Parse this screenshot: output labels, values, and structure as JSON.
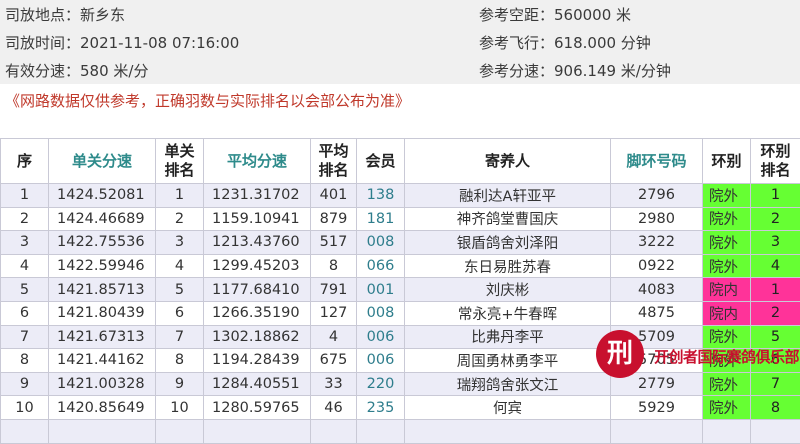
{
  "info": {
    "release_location": "司放地点：新乡东",
    "release_time": "司放时间：2021-11-08 07:16:00",
    "valid_speed": "有效分速：580 米/分",
    "ref_distance": "参考空距：560000 米",
    "ref_flight": "参考飞行：618.000 分钟",
    "ref_speed": "参考分速：906.149 米/分钟"
  },
  "notice": "《网路数据仅供参考，正确羽数与实际排名以会部公布为准》",
  "table": {
    "headers": {
      "seq": "序",
      "single_speed": "单关分速",
      "single_rank": "单关排名",
      "avg_speed": "平均分速",
      "avg_rank": "平均排名",
      "member": "会员",
      "owner": "寄养人",
      "ring": "脚环号码",
      "zone": "环别",
      "zone_rank": "环别排名"
    },
    "rows": [
      {
        "seq": "1",
        "single_speed": "1424.52081",
        "single_rank": "1",
        "avg_speed": "1231.31702",
        "avg_rank": "401",
        "member": "138",
        "owner": "融利达A轩亚平",
        "ring": "2796",
        "zone": "院外",
        "zone_rank": "1"
      },
      {
        "seq": "2",
        "single_speed": "1424.46689",
        "single_rank": "2",
        "avg_speed": "1159.10941",
        "avg_rank": "879",
        "member": "181",
        "owner": "神齐鸽堂曹国庆",
        "ring": "2980",
        "zone": "院外",
        "zone_rank": "2"
      },
      {
        "seq": "3",
        "single_speed": "1422.75536",
        "single_rank": "3",
        "avg_speed": "1213.43760",
        "avg_rank": "517",
        "member": "008",
        "owner": "银盾鸽舍刘泽阳",
        "ring": "3222",
        "zone": "院外",
        "zone_rank": "3"
      },
      {
        "seq": "4",
        "single_speed": "1422.59946",
        "single_rank": "4",
        "avg_speed": "1299.45203",
        "avg_rank": "8",
        "member": "066",
        "owner": "东日易胜苏春",
        "ring": "0922",
        "zone": "院外",
        "zone_rank": "4"
      },
      {
        "seq": "5",
        "single_speed": "1421.85713",
        "single_rank": "5",
        "avg_speed": "1177.68410",
        "avg_rank": "791",
        "member": "001",
        "owner": "刘庆彬",
        "ring": "4083",
        "zone": "院内",
        "zone_rank": "1"
      },
      {
        "seq": "6",
        "single_speed": "1421.80439",
        "single_rank": "6",
        "avg_speed": "1266.35190",
        "avg_rank": "127",
        "member": "008",
        "owner": "常永亮+牛春晖",
        "ring": "4875",
        "zone": "院内",
        "zone_rank": "2"
      },
      {
        "seq": "7",
        "single_speed": "1421.67313",
        "single_rank": "7",
        "avg_speed": "1302.18862",
        "avg_rank": "4",
        "member": "006",
        "owner": "比弗丹李平",
        "ring": "5709",
        "zone": "院外",
        "zone_rank": "5"
      },
      {
        "seq": "8",
        "single_speed": "1421.44162",
        "single_rank": "8",
        "avg_speed": "1194.28439",
        "avg_rank": "675",
        "member": "006",
        "owner": "周国勇林勇李平",
        "ring": "5705",
        "zone": "院外",
        "zone_rank": "6"
      },
      {
        "seq": "9",
        "single_speed": "1421.00328",
        "single_rank": "9",
        "avg_speed": "1284.40551",
        "avg_rank": "33",
        "member": "220",
        "owner": "瑞翔鸽舍张文江",
        "ring": "2779",
        "zone": "院外",
        "zone_rank": "7"
      },
      {
        "seq": "10",
        "single_speed": "1420.85649",
        "single_rank": "10",
        "avg_speed": "1280.59765",
        "avg_rank": "46",
        "member": "235",
        "owner": "何宾",
        "ring": "5929",
        "zone": "院外",
        "zone_rank": "8"
      },
      {
        "seq": "",
        "single_speed": "",
        "single_rank": "",
        "avg_speed": "",
        "avg_rank": "",
        "member": "",
        "owner": "",
        "ring": "",
        "zone": "",
        "zone_rank": ""
      }
    ]
  },
  "watermark": {
    "seal": "刑",
    "text": "开创者国际赛鸽俱乐部"
  },
  "colors": {
    "zone_out": "#66ff33",
    "zone_in": "#ff3399",
    "link": "#2e8b8b",
    "notice": "#c0392b"
  }
}
